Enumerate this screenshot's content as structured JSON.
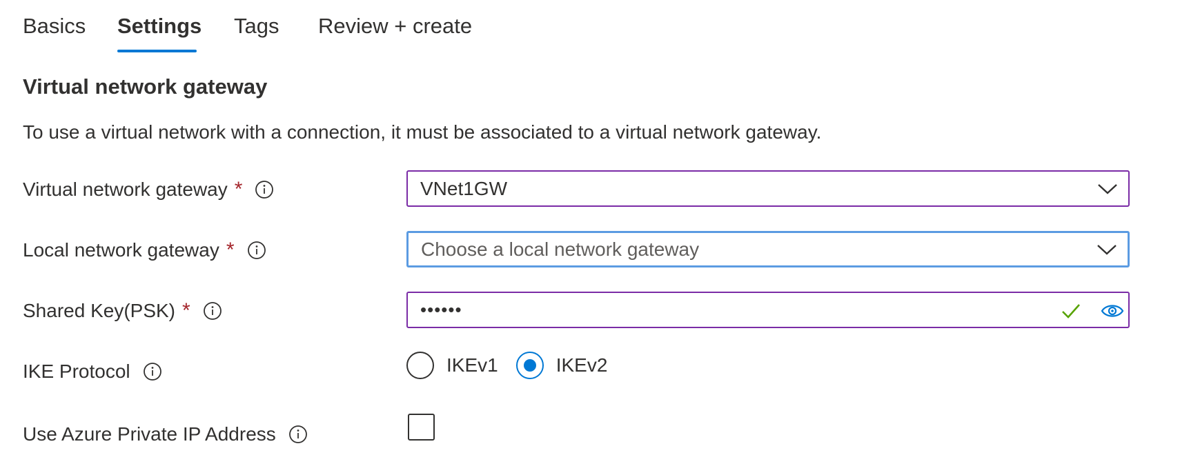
{
  "tabs": [
    {
      "label": "Basics",
      "active": false
    },
    {
      "label": "Settings",
      "active": true
    },
    {
      "label": "Tags",
      "active": false
    },
    {
      "label": "Review + create",
      "active": false
    }
  ],
  "section": {
    "title": "Virtual network gateway",
    "description": "To use a virtual network with a connection, it must be associated to a virtual network gateway."
  },
  "fields": {
    "virtual_network_gateway": {
      "label": "Virtual network gateway",
      "required_mark": "*",
      "value": "VNet1GW"
    },
    "local_network_gateway": {
      "label": "Local network gateway",
      "required_mark": "*",
      "placeholder": "Choose a local network gateway"
    },
    "shared_key": {
      "label": "Shared Key(PSK)",
      "required_mark": "*",
      "masked_value": "••••••"
    },
    "ike_protocol": {
      "label": "IKE Protocol",
      "options": [
        "IKEv1",
        "IKEv2"
      ],
      "selected": "IKEv2"
    },
    "private_ip": {
      "label": "Use Azure Private IP Address",
      "checked": false
    }
  },
  "colors": {
    "accent": "#0078d4",
    "required": "#a4262c",
    "field_border": "#7a2ba6",
    "focus_border": "#5b9be2",
    "valid_check": "#57a300"
  },
  "icons": [
    "info-icon",
    "chevron-down-icon",
    "check-icon",
    "eye-icon"
  ]
}
